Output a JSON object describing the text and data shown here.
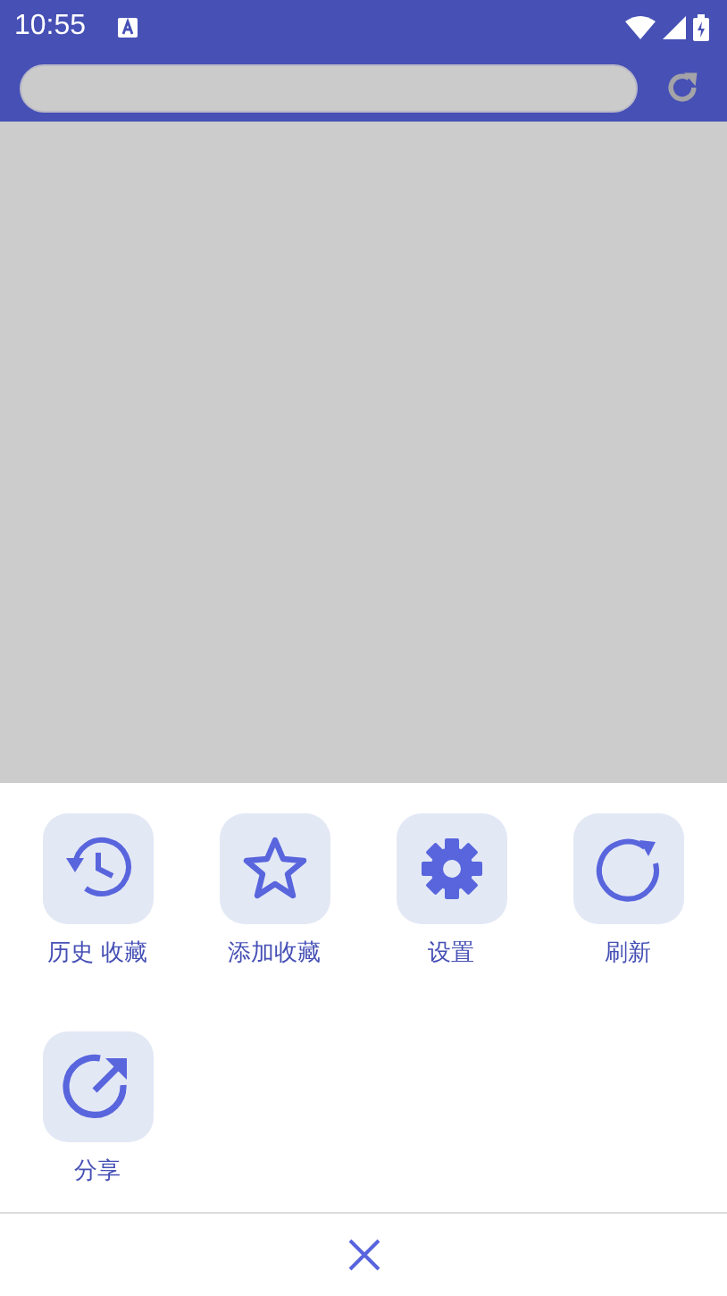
{
  "status_bar": {
    "time": "10:55"
  },
  "menu": {
    "items": [
      {
        "kind": "history",
        "label": "历史 收藏"
      },
      {
        "kind": "star",
        "label": "添加收藏"
      },
      {
        "kind": "settings",
        "label": "设置"
      },
      {
        "kind": "refresh",
        "label": "刷新"
      },
      {
        "kind": "share",
        "label": "分享"
      }
    ]
  }
}
